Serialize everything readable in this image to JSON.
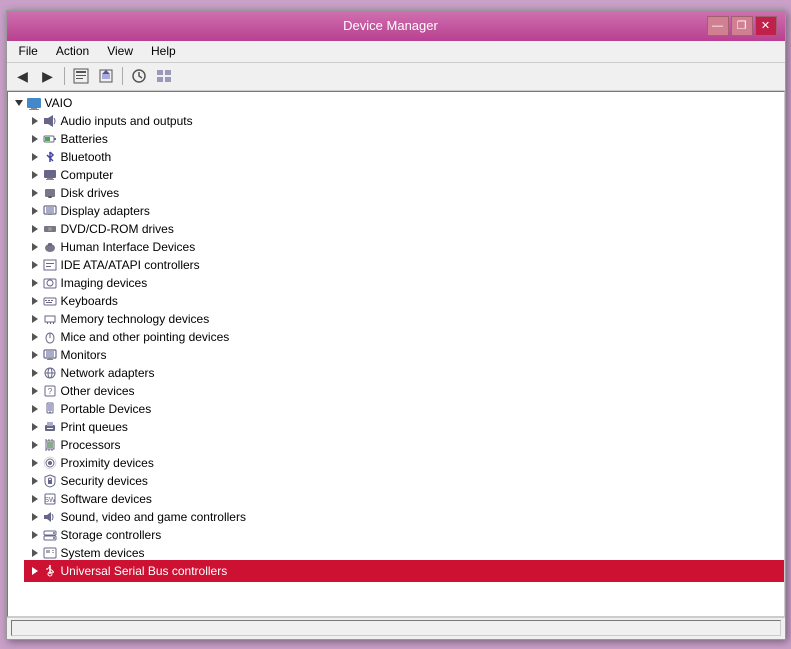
{
  "window": {
    "title": "Device Manager",
    "controls": {
      "minimize": "—",
      "restore": "❐",
      "close": "✕"
    }
  },
  "menu": {
    "items": [
      "File",
      "Action",
      "View",
      "Help"
    ]
  },
  "toolbar": {
    "buttons": [
      "◀",
      "▶",
      "⬛",
      "⊞",
      "☰",
      "|",
      "✏",
      "☰",
      "|",
      "⚙"
    ]
  },
  "tree": {
    "root_label": "VAIO",
    "items": [
      {
        "label": "Audio inputs and outputs",
        "icon": "🔊",
        "highlighted": false
      },
      {
        "label": "Batteries",
        "icon": "🔋",
        "highlighted": false
      },
      {
        "label": "Bluetooth",
        "icon": "📶",
        "highlighted": false
      },
      {
        "label": "Computer",
        "icon": "💻",
        "highlighted": false
      },
      {
        "label": "Disk drives",
        "icon": "💾",
        "highlighted": false
      },
      {
        "label": "Display adapters",
        "icon": "🖥",
        "highlighted": false
      },
      {
        "label": "DVD/CD-ROM drives",
        "icon": "💿",
        "highlighted": false
      },
      {
        "label": "Human Interface Devices",
        "icon": "🖱",
        "highlighted": false
      },
      {
        "label": "IDE ATA/ATAPI controllers",
        "icon": "📋",
        "highlighted": false
      },
      {
        "label": "Imaging devices",
        "icon": "📷",
        "highlighted": false
      },
      {
        "label": "Keyboards",
        "icon": "⌨",
        "highlighted": false
      },
      {
        "label": "Memory technology devices",
        "icon": "💳",
        "highlighted": false
      },
      {
        "label": "Mice and other pointing devices",
        "icon": "🖱",
        "highlighted": false
      },
      {
        "label": "Monitors",
        "icon": "🖥",
        "highlighted": false
      },
      {
        "label": "Network adapters",
        "icon": "🌐",
        "highlighted": false
      },
      {
        "label": "Other devices",
        "icon": "📋",
        "highlighted": false
      },
      {
        "label": "Portable Devices",
        "icon": "📱",
        "highlighted": false
      },
      {
        "label": "Print queues",
        "icon": "🖨",
        "highlighted": false
      },
      {
        "label": "Processors",
        "icon": "⚙",
        "highlighted": false
      },
      {
        "label": "Proximity devices",
        "icon": "📡",
        "highlighted": false
      },
      {
        "label": "Security devices",
        "icon": "🔒",
        "highlighted": false
      },
      {
        "label": "Software devices",
        "icon": "📋",
        "highlighted": false
      },
      {
        "label": "Sound, video and game controllers",
        "icon": "🔊",
        "highlighted": false
      },
      {
        "label": "Storage controllers",
        "icon": "💾",
        "highlighted": false
      },
      {
        "label": "System devices",
        "icon": "⚙",
        "highlighted": false
      },
      {
        "label": "Universal Serial Bus controllers",
        "icon": "🔌",
        "highlighted": true
      }
    ]
  }
}
